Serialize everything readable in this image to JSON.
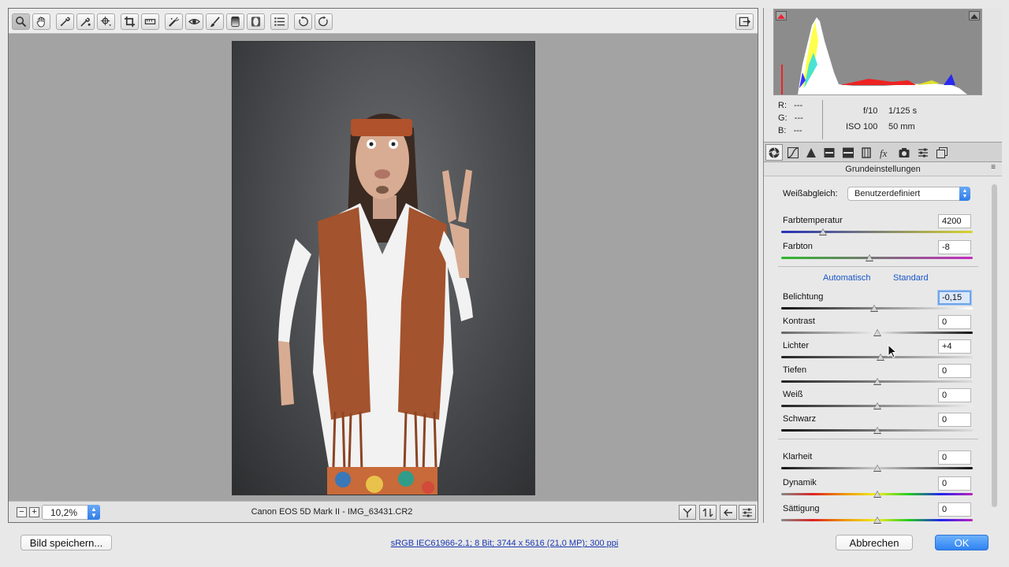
{
  "colors": {
    "accent": "#2f82f2",
    "link": "#1a55c8",
    "canvas_bg": "#a3a3a3"
  },
  "toolbar": {
    "tools": [
      "zoom-icon",
      "hand-icon",
      "white-balance-eyedropper-icon",
      "color-sampler-icon",
      "target-adjust-icon",
      "crop-icon",
      "straighten-icon",
      "spot-removal-icon",
      "red-eye-icon",
      "adjustment-brush-icon",
      "graduated-filter-icon",
      "radial-filter-icon",
      "preferences-list-icon",
      "rotate-left-icon",
      "rotate-right-icon"
    ],
    "export_icon": "open-export-icon"
  },
  "status": {
    "zoom_minus": "−",
    "zoom_plus": "+",
    "zoom": "10,2%",
    "camera": "Canon EOS 5D Mark II  -  IMG_63431.CR2"
  },
  "histogram": {
    "r_label": "R:",
    "g_label": "G:",
    "b_label": "B:",
    "r": "---",
    "g": "---",
    "b": "---",
    "aperture": "f/10",
    "shutter": "1/125 s",
    "iso": "ISO 100",
    "focal": "50 mm"
  },
  "panel": {
    "title": "Grundeinstellungen",
    "menu_icon": "≡",
    "wb_label": "Weißabgleich:",
    "wb_value": "Benutzerdefiniert",
    "auto": "Automatisch",
    "standard": "Standard",
    "sliders": [
      {
        "label": "Farbtemperatur",
        "value": "4200",
        "pos": 0.22
      },
      {
        "label": "Farbton",
        "value": "-8",
        "pos": 0.46
      },
      {
        "label": "Belichtung",
        "value": "-0,15",
        "pos": 0.485
      },
      {
        "label": "Kontrast",
        "value": "0",
        "pos": 0.5
      },
      {
        "label": "Lichter",
        "value": "+4",
        "pos": 0.52
      },
      {
        "label": "Tiefen",
        "value": "0",
        "pos": 0.5
      },
      {
        "label": "Weiß",
        "value": "0",
        "pos": 0.5
      },
      {
        "label": "Schwarz",
        "value": "0",
        "pos": 0.5
      },
      {
        "label": "Klarheit",
        "value": "0",
        "pos": 0.5
      },
      {
        "label": "Dynamik",
        "value": "0",
        "pos": 0.5
      },
      {
        "label": "Sättigung",
        "value": "0",
        "pos": 0.5
      }
    ]
  },
  "footer": {
    "save": "Bild speichern...",
    "color_info": "sRGB IEC61966-2.1; 8 Bit; 3744 x 5616 (21,0 MP); 300 ppi",
    "cancel": "Abbrechen",
    "ok": "OK"
  }
}
